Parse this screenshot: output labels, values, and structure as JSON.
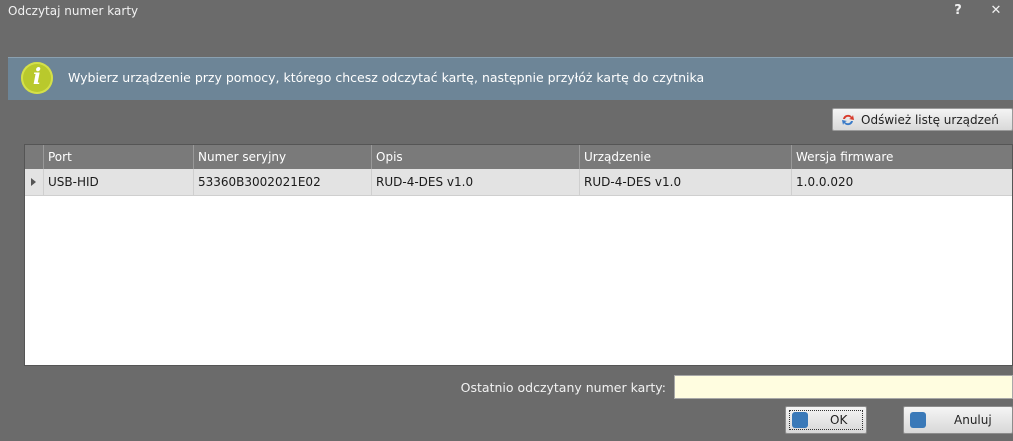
{
  "dialog": {
    "title": "Odczytaj numer karty",
    "help_glyph": "?",
    "close_glyph": "✕"
  },
  "info": {
    "icon": "info-icon",
    "icon_glyph": "i",
    "message": "Wybierz urządzenie przy pomocy, którego chcesz odczytać kartę, następnie przyłóż kartę do czytnika"
  },
  "toolbar": {
    "refresh_label": "Odśwież listę urządzeń",
    "refresh_icon": "refresh-icon"
  },
  "grid": {
    "columns": [
      "Port",
      "Numer seryjny",
      "Opis",
      "Urządzenie",
      "Wersja firmware"
    ],
    "rows": [
      [
        "USB-HID",
        "53360B3002021E02",
        "RUD-4-DES v1.0",
        "RUD-4-DES v1.0",
        "1.0.0.020"
      ]
    ]
  },
  "footer": {
    "last_card_label": "Ostatnio odczytany numer karty:",
    "last_card_value": "",
    "ok_label": "OK",
    "cancel_label": "Anuluj"
  },
  "colors": {
    "title_bg": "#6b6b6b",
    "info_bg": "#6d8597",
    "info_icon": "#b9c92c",
    "grid_header_bg": "#7a7a7a",
    "selected_row_bg": "#e3e3e3",
    "input_bg": "#fffde0"
  }
}
